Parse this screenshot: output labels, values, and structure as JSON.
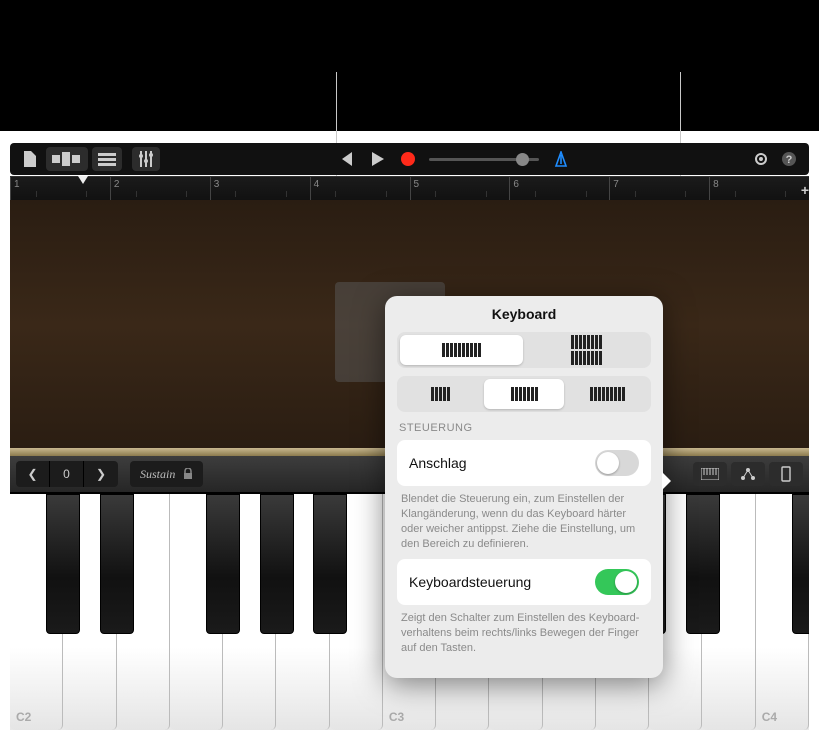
{
  "toolbar": {
    "rewind_icon": "rewind-icon",
    "play_icon": "play-icon",
    "record_icon": "record-icon",
    "metronome_icon": "metronome-icon",
    "settings_icon": "gear-icon",
    "help_icon": "help-icon"
  },
  "ruler": {
    "bars": [
      "1",
      "2",
      "3",
      "4",
      "5",
      "6",
      "7",
      "8"
    ]
  },
  "controls": {
    "octave_value": "0",
    "sustain_label": "Sustain"
  },
  "keyboard": {
    "octave_labels": [
      "C2",
      "C3",
      "C4"
    ]
  },
  "popover": {
    "title": "Keyboard",
    "section_label": "STEUERUNG",
    "anschlag": {
      "label": "Anschlag",
      "on": false,
      "desc": "Blendet die Steuerung ein, zum Einstellen der Klangänderung, wenn du das Keyboard härter oder weicher antippst. Ziehe die Einstellung, um den Bereich zu definieren."
    },
    "keyboardsteuerung": {
      "label": "Keyboardsteuerung",
      "on": true,
      "desc": "Zeigt den Schalter zum Einstellen des Keyboard-verhaltens beim rechts/links Bewegen der Finger auf den Tasten."
    },
    "row1_selected": 0,
    "row2_selected": 1
  }
}
